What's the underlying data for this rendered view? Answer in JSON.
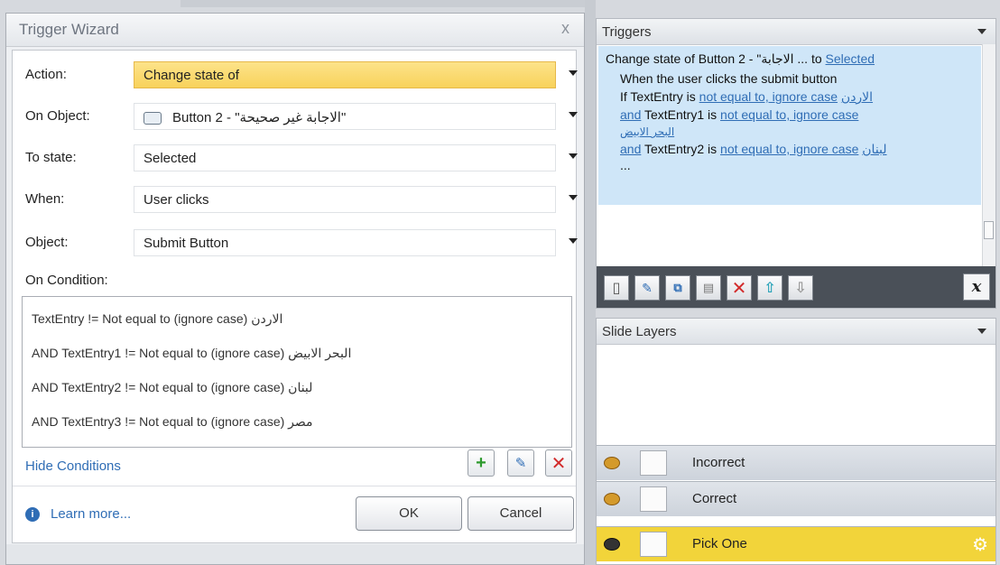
{
  "dialog": {
    "title": "Trigger Wizard",
    "close_glyph": "x",
    "fields": [
      {
        "label": "Action:",
        "value": "Change state of"
      },
      {
        "label": "On Object:",
        "value": "Button 2 - \"الاجابة غير صحيحة\""
      },
      {
        "label": "To state:",
        "value": "Selected"
      },
      {
        "label": "When:",
        "value": "User clicks"
      },
      {
        "label": "Object:",
        "value": "Submit Button"
      }
    ],
    "on_condition_label": "On Condition:",
    "conditions": [
      "TextEntry != Not equal to (ignore case) الاردن",
      "AND TextEntry1 != Not equal to (ignore case) البحر الابيض",
      "AND TextEntry2 != Not equal to (ignore case) لبنان",
      "AND TextEntry3 != Not equal to (ignore case) مصر"
    ],
    "hide_conditions": "Hide Conditions",
    "learn_more": "Learn more...",
    "ok": "OK",
    "cancel": "Cancel"
  },
  "triggers": {
    "title": "Triggers",
    "line1_prefix": "Change state of Button 2 - \"الاجابة ... to ",
    "line1_link": "Selected",
    "line2": "When the user clicks the submit button",
    "line3_prefix": "If TextEntry is ",
    "line3_link": "not equal to, ignore case",
    "line3_value": "الاردن",
    "line4_and": "and",
    "line4_mid": " TextEntry1 is ",
    "line4_link": "not equal to, ignore case",
    "line5_value": "البحر الابيض",
    "line6_and": "and",
    "line6_mid": " TextEntry2 is ",
    "line6_link": "not equal to, ignore case",
    "line6_value": "لبنان",
    "line7": "..."
  },
  "toolbar": {
    "variable_label": "x"
  },
  "layers": {
    "title": "Slide Layers",
    "items": [
      {
        "name": "Incorrect"
      },
      {
        "name": "Correct"
      },
      {
        "name": "Pick One"
      }
    ]
  },
  "colors": {
    "accent": "#f2d43a",
    "link": "#2f6db5",
    "selection": "#cfe6f8"
  }
}
